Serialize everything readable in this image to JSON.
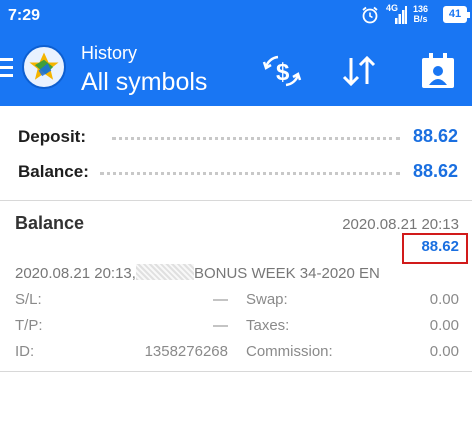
{
  "status_bar": {
    "time": "7:29",
    "network": "4G",
    "speed_value": "136",
    "speed_unit": "B/s",
    "battery": "41",
    "icons": [
      "alarm-icon",
      "signal-icon",
      "battery-icon"
    ]
  },
  "app_bar": {
    "title": "History",
    "subtitle": "All symbols",
    "icons": [
      "menu-icon",
      "app-logo",
      "exchange-icon",
      "sort-icon",
      "calendar-icon"
    ],
    "color": "#1976f3"
  },
  "summary": {
    "deposit_label": "Deposit:",
    "deposit_value": "88.62",
    "balance_label": "Balance:",
    "balance_value": "88.62"
  },
  "deal": {
    "title": "Balance",
    "time": "2020.08.21 20:13",
    "amount": "88.62",
    "comment_prefix": "2020.08.21 20:13,",
    "comment_suffix": "BONUS WEEK 34-2020 EN",
    "sl_label": "S/L:",
    "sl_value": "—",
    "tp_label": "T/P:",
    "tp_value": "—",
    "id_label": "ID:",
    "id_value": "1358276268",
    "swap_label": "Swap:",
    "swap_value": "0.00",
    "taxes_label": "Taxes:",
    "taxes_value": "0.00",
    "commission_label": "Commission:",
    "commission_value": "0.00"
  },
  "colors": {
    "accent": "#1a6fe0",
    "highlight_box": "#d11a1a"
  }
}
